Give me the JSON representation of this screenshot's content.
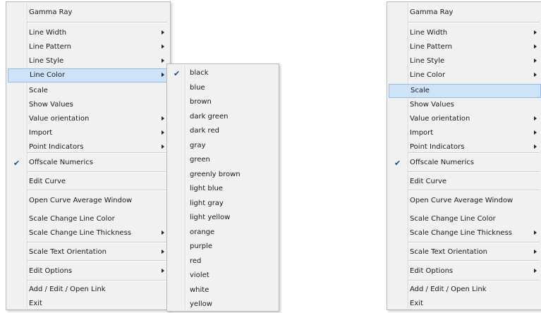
{
  "left_menu": {
    "items": [
      {
        "label": "Gamma Ray",
        "arrow": false,
        "checked": false
      },
      {
        "label": "Line Width",
        "arrow": true,
        "checked": false
      },
      {
        "label": "Line Pattern",
        "arrow": true,
        "checked": false
      },
      {
        "label": "Line Style",
        "arrow": true,
        "checked": false
      },
      {
        "label": "Line Color",
        "arrow": true,
        "checked": false,
        "highlighted": true
      },
      {
        "label": "Scale",
        "arrow": false,
        "checked": false
      },
      {
        "label": "Show Values",
        "arrow": false,
        "checked": false
      },
      {
        "label": "Value orientation",
        "arrow": true,
        "checked": false
      },
      {
        "label": "Import",
        "arrow": true,
        "checked": false
      },
      {
        "label": "Point Indicators",
        "arrow": true,
        "checked": false
      },
      {
        "label": "Offscale Numerics",
        "arrow": false,
        "checked": true
      },
      {
        "label": "Edit Curve",
        "arrow": false,
        "checked": false
      },
      {
        "label": "Open Curve Average Window",
        "arrow": false,
        "checked": false
      },
      {
        "label": "Scale Change Line Color",
        "arrow": false,
        "checked": false
      },
      {
        "label": "Scale Change Line Thickness",
        "arrow": true,
        "checked": false
      },
      {
        "label": "Scale Text Orientation",
        "arrow": true,
        "checked": false
      },
      {
        "label": "Edit Options",
        "arrow": true,
        "checked": false
      },
      {
        "label": "Add / Edit / Open Link",
        "arrow": false,
        "checked": false
      },
      {
        "label": "Exit",
        "arrow": false,
        "checked": false
      }
    ]
  },
  "color_submenu": {
    "items": [
      {
        "label": "black",
        "checked": true
      },
      {
        "label": "blue",
        "checked": false
      },
      {
        "label": "brown",
        "checked": false
      },
      {
        "label": "dark green",
        "checked": false
      },
      {
        "label": "dark red",
        "checked": false
      },
      {
        "label": "gray",
        "checked": false
      },
      {
        "label": "green",
        "checked": false
      },
      {
        "label": "greenly brown",
        "checked": false
      },
      {
        "label": "light blue",
        "checked": false
      },
      {
        "label": "light gray",
        "checked": false
      },
      {
        "label": "light yellow",
        "checked": false
      },
      {
        "label": "orange",
        "checked": false
      },
      {
        "label": "purple",
        "checked": false
      },
      {
        "label": "red",
        "checked": false
      },
      {
        "label": "violet",
        "checked": false
      },
      {
        "label": "white",
        "checked": false
      },
      {
        "label": "yellow",
        "checked": false
      }
    ]
  },
  "right_menu": {
    "items": [
      {
        "label": "Gamma Ray",
        "arrow": false,
        "checked": false
      },
      {
        "label": "Line Width",
        "arrow": true,
        "checked": false
      },
      {
        "label": "Line Pattern",
        "arrow": true,
        "checked": false
      },
      {
        "label": "Line Style",
        "arrow": true,
        "checked": false
      },
      {
        "label": "Line Color",
        "arrow": true,
        "checked": false
      },
      {
        "label": "Scale",
        "arrow": false,
        "checked": false,
        "highlighted": true
      },
      {
        "label": "Show Values",
        "arrow": false,
        "checked": false
      },
      {
        "label": "Value orientation",
        "arrow": true,
        "checked": false
      },
      {
        "label": "Import",
        "arrow": true,
        "checked": false
      },
      {
        "label": "Point Indicators",
        "arrow": true,
        "checked": false
      },
      {
        "label": "Offscale Numerics",
        "arrow": false,
        "checked": true
      },
      {
        "label": "Edit Curve",
        "arrow": false,
        "checked": false
      },
      {
        "label": "Open Curve Average Window",
        "arrow": false,
        "checked": false
      },
      {
        "label": "Scale Change Line Color",
        "arrow": false,
        "checked": false
      },
      {
        "label": "Scale Change Line Thickness",
        "arrow": true,
        "checked": false
      },
      {
        "label": "Scale Text Orientation",
        "arrow": true,
        "checked": false
      },
      {
        "label": "Edit Options",
        "arrow": true,
        "checked": false
      },
      {
        "label": "Add / Edit / Open Link",
        "arrow": false,
        "checked": false
      },
      {
        "label": "Exit",
        "arrow": false,
        "checked": false
      }
    ]
  },
  "colors": {
    "menu_bg": "#f1f1f1",
    "highlight_bg": "#cfe3f8",
    "highlight_border": "#93bde8",
    "check_color": "#1d4a8c"
  },
  "icons": {
    "check": "check-icon",
    "submenu": "chevron-right-icon"
  }
}
